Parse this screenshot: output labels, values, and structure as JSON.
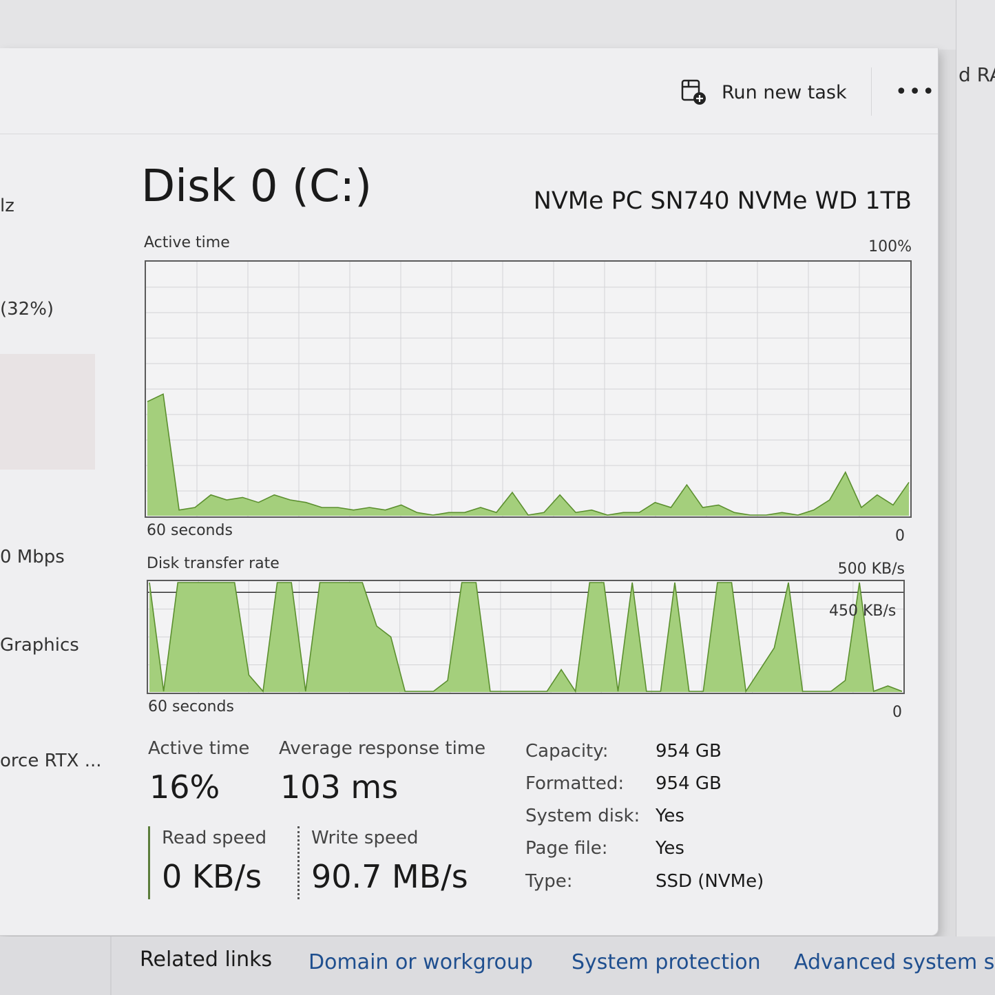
{
  "background_window": {
    "right_edge_text": "d RA"
  },
  "toolbar": {
    "run_new_task_label": "Run new task",
    "more_label": "•••"
  },
  "sidebar": {
    "partial_labels": [
      "lz",
      "(32%)",
      "0 Mbps",
      "Graphics",
      "orce RTX ..."
    ]
  },
  "disk": {
    "title": "Disk 0 (C:)",
    "model": "NVMe PC SN740 NVMe WD 1TB"
  },
  "active_time_chart": {
    "title": "Active time",
    "max_label": "100%",
    "duration_label": "60 seconds",
    "min_label": "0",
    "fill_color": "#a4cf7c",
    "line_color": "#5b8f2e",
    "values": [
      45,
      48,
      2,
      3,
      8,
      6,
      7,
      5,
      8,
      6,
      5,
      3,
      3,
      2,
      3,
      2,
      4,
      1,
      0,
      1,
      1,
      3,
      1,
      9,
      0,
      1,
      8,
      1,
      2,
      0,
      1,
      1,
      5,
      3,
      12,
      3,
      4,
      1,
      0,
      0,
      1,
      0,
      2,
      6,
      17,
      3,
      8,
      4,
      13
    ]
  },
  "transfer_rate_chart": {
    "title": "Disk transfer rate",
    "max_label": "500 KB/s",
    "ref_line_label": "450 KB/s",
    "duration_label": "60 seconds",
    "min_label": "0",
    "fill_color": "#a4cf7c",
    "line_color": "#5b8f2e",
    "values": [
      100,
      0,
      100,
      100,
      100,
      100,
      100,
      15,
      0,
      100,
      100,
      0,
      100,
      100,
      100,
      100,
      60,
      50,
      0,
      0,
      0,
      10,
      100,
      100,
      0,
      0,
      0,
      0,
      0,
      20,
      0,
      100,
      100,
      0,
      100,
      0,
      0,
      100,
      0,
      0,
      100,
      100,
      0,
      20,
      40,
      100,
      0,
      0,
      0,
      10,
      100,
      0,
      5,
      0
    ]
  },
  "stats": {
    "active_time_label": "Active time",
    "active_time_value": "16%",
    "avg_response_label": "Average response time",
    "avg_response_value": "103 ms",
    "read_speed_label": "Read speed",
    "read_speed_value": "0 KB/s",
    "write_speed_label": "Write speed",
    "write_speed_value": "90.7 MB/s"
  },
  "properties": [
    {
      "label": "Capacity:",
      "value": "954 GB"
    },
    {
      "label": "Formatted:",
      "value": "954 GB"
    },
    {
      "label": "System disk:",
      "value": "Yes"
    },
    {
      "label": "Page file:",
      "value": "Yes"
    },
    {
      "label": "Type:",
      "value": "SSD (NVMe)"
    }
  ],
  "related_links": {
    "title": "Related links",
    "links": [
      "Domain or workgroup",
      "System protection",
      "Advanced system se"
    ]
  }
}
